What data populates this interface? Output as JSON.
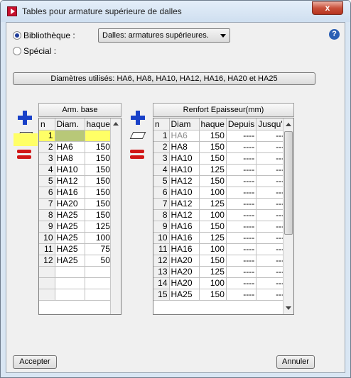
{
  "window": {
    "title": "Tables pour armature supérieure de dalles",
    "close_label": "x"
  },
  "source": {
    "options": [
      {
        "label": "Bibliothèque :",
        "selected": true
      },
      {
        "label": "Spécial :",
        "selected": false
      }
    ],
    "library_value": "Dalles: armatures supérieures."
  },
  "help_label": "?",
  "diameters_button": "Diamètres utilisés: HA6, HA8, HA10, HA12, HA16, HA20 et HA25",
  "left_table": {
    "header": "Arm. base",
    "columns": [
      "n",
      "Diam.",
      "haque"
    ],
    "rows": [
      [
        "1",
        "",
        ""
      ],
      [
        "2",
        "HA6",
        "150"
      ],
      [
        "3",
        "HA8",
        "150"
      ],
      [
        "4",
        "HA10",
        "150"
      ],
      [
        "5",
        "HA12",
        "150"
      ],
      [
        "6",
        "HA16",
        "150"
      ],
      [
        "7",
        "HA20",
        "150"
      ],
      [
        "8",
        "HA25",
        "150"
      ],
      [
        "9",
        "HA25",
        "125"
      ],
      [
        "10",
        "HA25",
        "100"
      ],
      [
        "11",
        "HA25",
        "75"
      ],
      [
        "12",
        "HA25",
        "50"
      ],
      [
        "",
        "",
        ""
      ],
      [
        "",
        "",
        ""
      ],
      [
        "",
        "",
        ""
      ]
    ]
  },
  "right_table": {
    "header": "Renfort Epaisseur(mm)",
    "columns": [
      "n",
      "Diam",
      "haque",
      "Depuis",
      "Jusqu'à"
    ],
    "rows": [
      [
        "1",
        "HA6",
        "150",
        "----",
        "----"
      ],
      [
        "2",
        "HA8",
        "150",
        "----",
        "----"
      ],
      [
        "3",
        "HA10",
        "150",
        "----",
        "----"
      ],
      [
        "4",
        "HA10",
        "125",
        "----",
        "----"
      ],
      [
        "5",
        "HA12",
        "150",
        "----",
        "----"
      ],
      [
        "6",
        "HA10",
        "100",
        "----",
        "----"
      ],
      [
        "7",
        "HA12",
        "125",
        "----",
        "----"
      ],
      [
        "8",
        "HA12",
        "100",
        "----",
        "----"
      ],
      [
        "9",
        "HA16",
        "150",
        "----",
        "----"
      ],
      [
        "10",
        "HA16",
        "125",
        "----",
        "----"
      ],
      [
        "11",
        "HA16",
        "100",
        "----",
        "----"
      ],
      [
        "12",
        "HA20",
        "150",
        "----",
        "----"
      ],
      [
        "13",
        "HA20",
        "125",
        "----",
        "----"
      ],
      [
        "14",
        "HA20",
        "100",
        "----",
        "----"
      ],
      [
        "15",
        "HA25",
        "150",
        "----",
        "----"
      ]
    ]
  },
  "tools": [
    "add-row-icon",
    "erase-row-icon",
    "delete-row-icon"
  ],
  "footer": {
    "accept_label": "Accepter",
    "cancel_label": "Annuler"
  },
  "colors": {
    "selection": "#ffff66",
    "accent": "#1840c8",
    "delete": "#d01818"
  }
}
